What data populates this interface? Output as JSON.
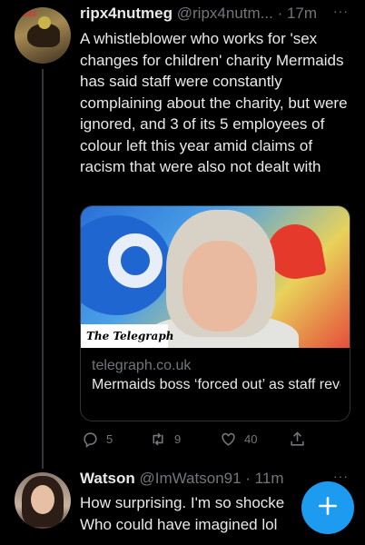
{
  "tweets": [
    {
      "display_name": "ripx4nutmeg",
      "handle": "@ripx4nutm...",
      "time": "· 17m",
      "more": "···",
      "text": "A whistleblower who works for 'sex changes for children' charity Mermaids has said staff were constantly complaining about the charity, but were ignored, and 3 of its 5 employees of colour left this year amid claims of racism that were also not dealt with",
      "card": {
        "image_tag": "The Telegraph",
        "domain": "telegraph.co.uk",
        "title": "Mermaids boss ‘forced out’ as staff revolted against her ‘inca..."
      },
      "actions": {
        "reply_count": "5",
        "retweet_count": "9",
        "like_count": "40"
      }
    },
    {
      "display_name": "Watson",
      "handle": "@ImWatson91",
      "time": "· 11m",
      "more": "···",
      "text": "How surprising. I'm so shocke Who could have imagined lol"
    }
  ],
  "icons": {
    "reply": "reply-icon",
    "retweet": "retweet-icon",
    "like": "heart-icon",
    "share": "share-icon",
    "compose": "plus-icon"
  },
  "colors": {
    "background": "#000000",
    "text": "#e7e9ea",
    "secondary": "#71767b",
    "accent": "#1d9bf0"
  }
}
